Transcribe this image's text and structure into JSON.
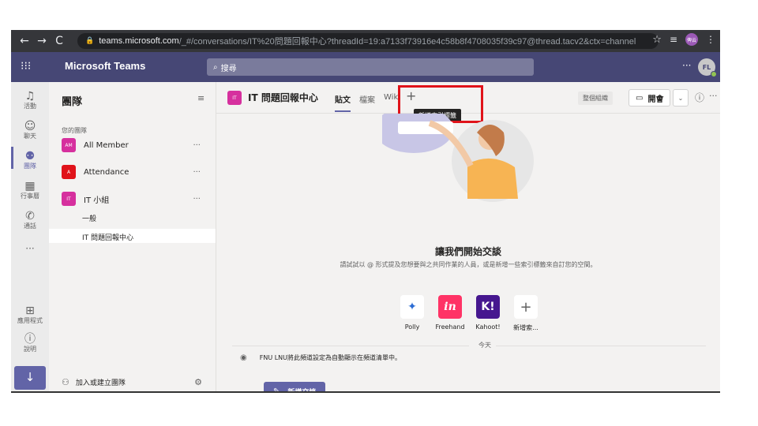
{
  "browser": {
    "back": "←",
    "forward": "→",
    "reload": "C",
    "url_host": "teams.microsoft.com",
    "url_rest": "/_#/conversations/IT%20問題回報中心?threadId=19:a7133f73916e4c58b8f4708035f39c97@thread.tacv2&ctx=channel",
    "star": "☆",
    "reading_list": "≡",
    "profile_text": "俾云",
    "menu": "⋮"
  },
  "header": {
    "apps": "⁝⁝⁝",
    "brand": "Microsoft Teams",
    "search_placeholder": "搜尋",
    "more": "···",
    "avatar_initials": "FL"
  },
  "rail": {
    "items": [
      {
        "icon": "🔔",
        "label": "活動"
      },
      {
        "icon": "💬",
        "label": "聊天"
      },
      {
        "icon": "👥",
        "label": "團隊"
      },
      {
        "icon": "📅",
        "label": "行事曆"
      },
      {
        "icon": "📞",
        "label": "通話"
      }
    ],
    "more": "···",
    "apps_label": "應用程式",
    "help_label": "說明",
    "download": "↓"
  },
  "panel": {
    "title": "團隊",
    "your_teams": "您的團隊",
    "teams": [
      {
        "tile": "AM",
        "name": "All Member",
        "color": "#d6309e"
      },
      {
        "tile": "A",
        "name": "Attendance",
        "color": "#e0131a"
      },
      {
        "tile": "IT",
        "name": "IT 小組",
        "color": "#d6309e"
      }
    ],
    "channels": [
      "一般",
      "IT 問題回報中心"
    ],
    "join_create": "加入或建立團隊"
  },
  "main": {
    "channel_tile": "IT",
    "channel_title": "IT 問題回報中心",
    "tabs": [
      "貼文",
      "檔案",
      "Wiki"
    ],
    "tab_add": "+",
    "tooltip": "新增索引標籤",
    "org_wide": "整個組織",
    "meet": "開會",
    "welcome_title": "讓我們開始交談",
    "welcome_sub": "請試試以 @ 形式提及您想要與之共同作業的人員，或是新增一些索引標籤來自訂您的空間。",
    "apps": [
      {
        "label": "Polly",
        "glyph": "✦",
        "color": "#ffffff",
        "fg": "#2b6cd4"
      },
      {
        "label": "Freehand",
        "glyph": "in",
        "color": "#ff3366",
        "fg": "#ffffff"
      },
      {
        "label": "Kahoot!",
        "glyph": "K!",
        "color": "#46178f",
        "fg": "#ffffff"
      },
      {
        "label": "新增索...",
        "glyph": "+",
        "color": "#ffffff",
        "fg": "#616161"
      }
    ],
    "date_divider": "今天",
    "system_message": "FNU LNU將此頻道設定為自動顯示在頻道清單中。",
    "new_conversation": "新增交談"
  }
}
